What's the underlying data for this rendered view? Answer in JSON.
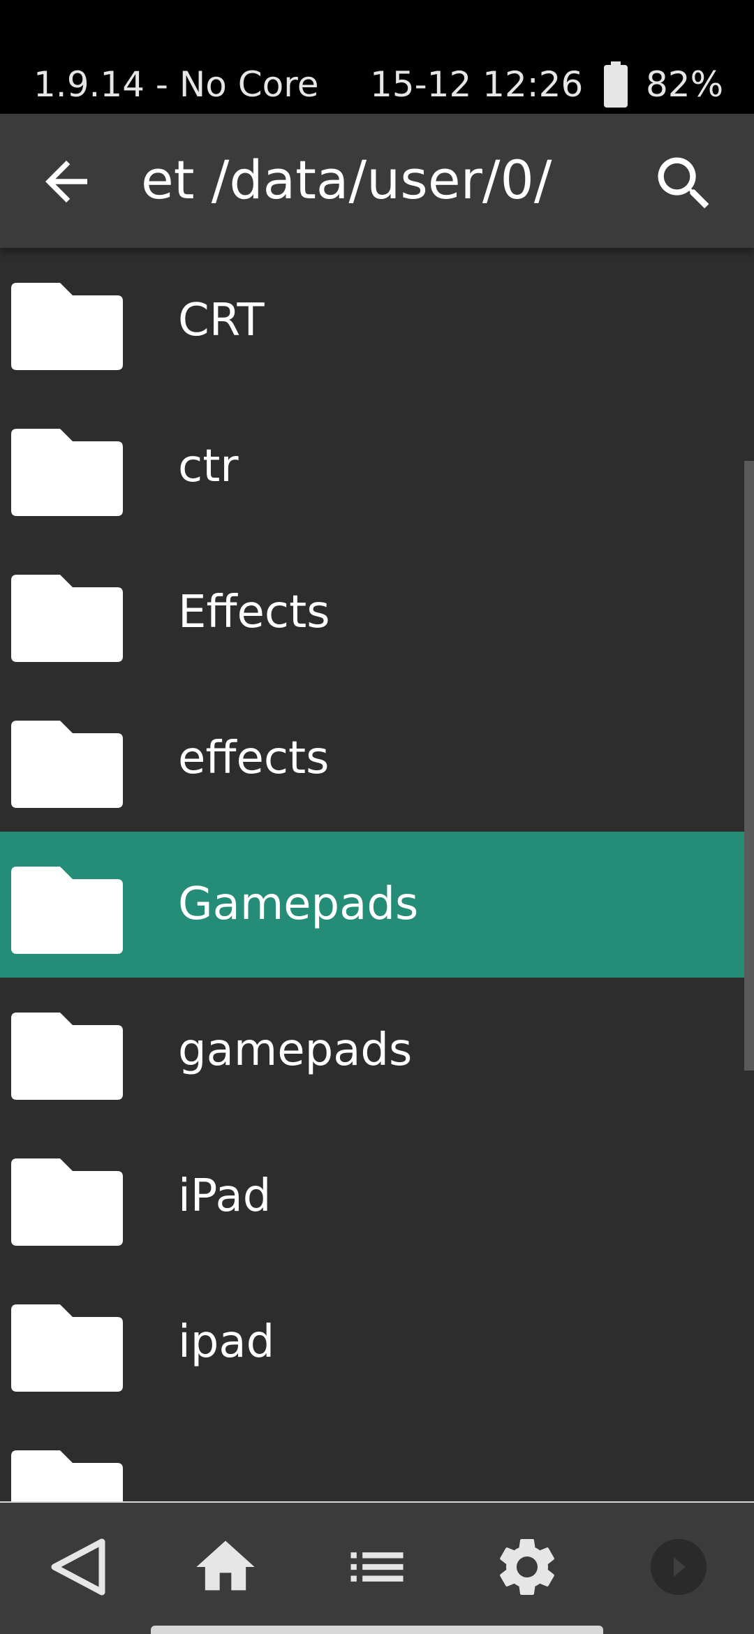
{
  "status_bar": {
    "left_text": "1.9.14 - No Core",
    "time": "15-12 12:26",
    "battery": "82%"
  },
  "toolbar": {
    "path": "et /data/user/0/",
    "back_icon": "arrow-left-icon",
    "search_icon": "search-icon"
  },
  "list": {
    "items": [
      {
        "label": "CRT",
        "selected": false
      },
      {
        "label": "ctr",
        "selected": false
      },
      {
        "label": "Effects",
        "selected": false
      },
      {
        "label": "effects",
        "selected": false
      },
      {
        "label": "Gamepads",
        "selected": true
      },
      {
        "label": "gamepads",
        "selected": false
      },
      {
        "label": "iPad",
        "selected": false
      },
      {
        "label": "ipad",
        "selected": false
      }
    ]
  },
  "nav_bar": {
    "items": [
      "back-triangle-icon",
      "home-icon",
      "list-icon",
      "gear-icon",
      "play-icon"
    ]
  },
  "colors": {
    "background": "#2d2d2d",
    "toolbar": "#3b3b3b",
    "selected": "#258c77",
    "text": "#ffffff"
  }
}
